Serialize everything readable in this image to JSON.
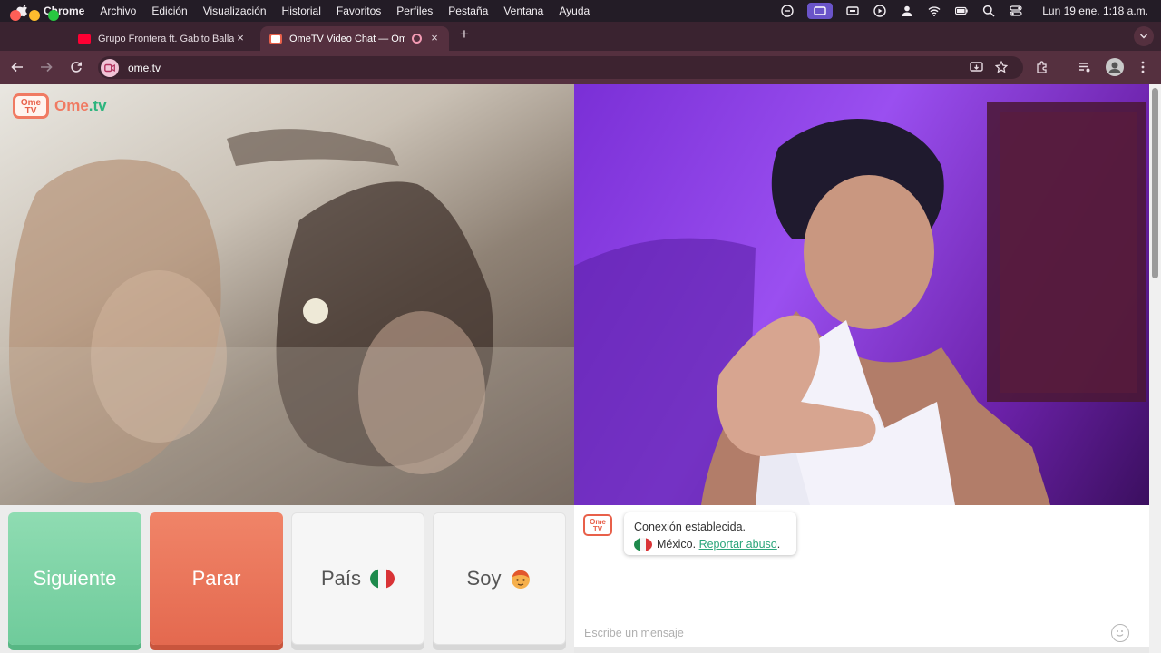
{
  "menubar": {
    "app": "Chrome",
    "items": [
      "Archivo",
      "Edición",
      "Visualización",
      "Historial",
      "Favoritos",
      "Perfiles",
      "Pestaña",
      "Ventana",
      "Ayuda"
    ],
    "datetime": "Lun 19 ene.  1:18 a.m."
  },
  "tabs": [
    {
      "title": "Grupo Frontera ft. Gabito Balla",
      "active": false
    },
    {
      "title": "OmeTV Video Chat — Omegle",
      "active": true
    }
  ],
  "address": {
    "url": "ome.tv"
  },
  "logo": {
    "badge_top": "Ome",
    "badge_bottom": "TV",
    "name_main": "Ome",
    "name_suffix": ".tv"
  },
  "controls": {
    "next_label": "Siguiente",
    "stop_label": "Parar",
    "country_label": "País",
    "gender_label": "Soy"
  },
  "chat": {
    "message_line1": "Conexión establecida.",
    "country": "México.",
    "report_link": "Reportar abuso",
    "report_suffix": ".",
    "input_placeholder": "Escribe un mensaje"
  },
  "colors": {
    "next": "#74cf9f",
    "stop": "#e8705a",
    "brand_orange": "#f07a62",
    "brand_green": "#2db57e",
    "link": "#2aa57a"
  }
}
